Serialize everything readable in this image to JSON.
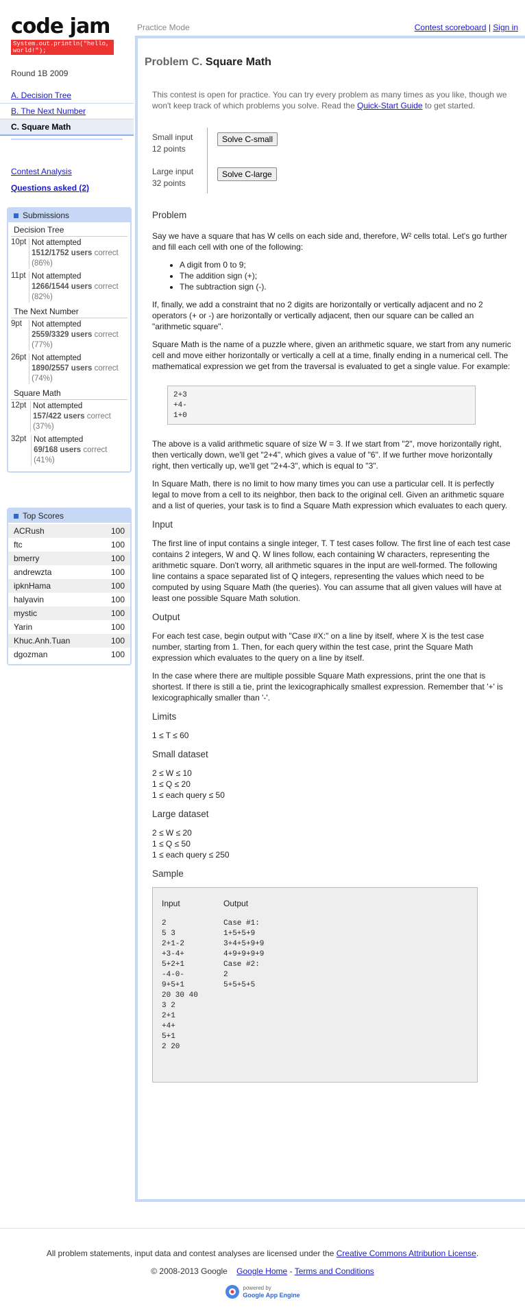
{
  "logo": {
    "text": "code jam",
    "sub": "System.out.println(\"hello, world!\");"
  },
  "round": "Round 1B 2009",
  "nav": [
    "A. Decision Tree",
    "B. The Next Number",
    "C. Square Math"
  ],
  "links": {
    "analysis": "Contest Analysis",
    "questions": "Questions asked (2)"
  },
  "submissions": {
    "title": "Submissions",
    "problems": [
      {
        "name": "Decision Tree",
        "rows": [
          {
            "pts": "10pt",
            "status": "Not attempted",
            "users": "1512/1752 users",
            "correct": "correct (86%)"
          },
          {
            "pts": "11pt",
            "status": "Not attempted",
            "users": "1266/1544 users",
            "correct": "correct (82%)"
          }
        ]
      },
      {
        "name": "The Next Number",
        "rows": [
          {
            "pts": "9pt",
            "status": "Not attempted",
            "users": "2559/3329 users",
            "correct": "correct (77%)"
          },
          {
            "pts": "26pt",
            "status": "Not attempted",
            "users": "1890/2557 users",
            "correct": "correct (74%)"
          }
        ]
      },
      {
        "name": "Square Math",
        "rows": [
          {
            "pts": "12pt",
            "status": "Not attempted",
            "users": "157/422 users",
            "correct": "correct (37%)"
          },
          {
            "pts": "32pt",
            "status": "Not attempted",
            "users": "69/168 users",
            "correct": "correct (41%)"
          }
        ]
      }
    ]
  },
  "topscores": {
    "title": "Top Scores",
    "rows": [
      {
        "name": "ACRush",
        "score": "100"
      },
      {
        "name": "ftc",
        "score": "100"
      },
      {
        "name": "bmerry",
        "score": "100"
      },
      {
        "name": "andrewzta",
        "score": "100"
      },
      {
        "name": "ipknHama",
        "score": "100"
      },
      {
        "name": "halyavin",
        "score": "100"
      },
      {
        "name": "mystic",
        "score": "100"
      },
      {
        "name": "Yarin",
        "score": "100"
      },
      {
        "name": "Khuc.Anh.Tuan",
        "score": "100"
      },
      {
        "name": "dgozman",
        "score": "100"
      }
    ]
  },
  "header": {
    "mode": "Practice Mode",
    "scoreboard": "Contest scoreboard",
    "sep": "|",
    "signin": "Sign in"
  },
  "problem": {
    "prefix": "Problem C.",
    "title": "Square Math",
    "notice": "This contest is open for practice. You can try every problem as many times as you like, though we won't keep track of which problems you solve. Read the",
    "notice_link": "Quick-Start Guide",
    "notice_end": "to get started.",
    "small_label": "Small input",
    "small_pts": "12 points",
    "small_btn": "Solve C-small",
    "large_label": "Large input",
    "large_pts": "32 points",
    "large_btn": "Solve C-large",
    "h_problem": "Problem",
    "p1": "Say we have a square that has W cells on each side and, therefore, W² cells total. Let's go further and fill each cell with one of the following:",
    "bullets": [
      "A digit from 0 to 9;",
      "The addition sign (+);",
      "The subtraction sign (-)."
    ],
    "p2": "If, finally, we add a constraint that no 2 digits are horizontally or vertically adjacent and no 2 operators (+ or -) are horizontally or vertically adjacent, then our square can be called an \"arithmetic square\".",
    "p3": "Square Math is the name of a puzzle where, given an arithmetic square, we start from any numeric cell and move either horizontally or vertically a cell at a time, finally ending in a numerical cell. The mathematical expression we get from the traversal is evaluated to get a single value. For example:",
    "example": "2+3\n+4-\n1+0",
    "p4": "The above is a valid arithmetic square of size W = 3. If we start from \"2\", move horizontally right, then vertically down, we'll get \"2+4\", which gives a value of \"6\". If we further move horizontally right, then vertically up, we'll get \"2+4-3\", which is equal to \"3\".",
    "p5": "In Square Math, there is no limit to how many times you can use a particular cell. It is perfectly legal to move from a cell to its neighbor, then back to the original cell. Given an arithmetic square and a list of queries, your task is to find a Square Math expression which evaluates to each query.",
    "h_input": "Input",
    "p6": "The first line of input contains a single integer, T. T test cases follow. The first line of each test case contains 2 integers, W and Q. W lines follow, each containing W characters, representing the arithmetic square. Don't worry, all arithmetic squares in the input are well-formed. The following line contains a space separated list of Q integers, representing the values which need to be computed by using Square Math (the queries). You can assume that all given values will have at least one possible Square Math solution.",
    "h_output": "Output",
    "p7": "For each test case, begin output with \"Case #X:\" on a line by itself, where X is the test case number, starting from 1. Then, for each query within the test case, print the Square Math expression which evaluates to the query on a line by itself.",
    "p8": "In the case where there are multiple possible Square Math expressions, print the one that is shortest. If there is still a tie, print the lexicographically smallest expression. Remember that '+' is lexicographically smaller than '-'.",
    "h_limits": "Limits",
    "limits": "1 ≤ T ≤ 60",
    "h_small": "Small dataset",
    "small": [
      "2 ≤ W ≤ 10",
      "1 ≤ Q ≤ 20",
      "1 ≤ each query ≤ 50"
    ],
    "h_large": "Large dataset",
    "large": [
      "2 ≤ W ≤ 20",
      "1 ≤ Q ≤ 50",
      "1 ≤ each query ≤ 250"
    ],
    "h_sample": "Sample",
    "sample_in_h": "Input",
    "sample_out_h": "Output",
    "sample_in": "2\n5 3\n2+1-2\n+3-4+\n5+2+1\n-4-0-\n9+5+1\n20 30 40\n3 2\n2+1\n+4+\n5+1\n2 20",
    "sample_out": "Case #1:\n1+5+5+9\n3+4+5+9+9\n4+9+9+9+9\nCase #2:\n2\n5+5+5+5"
  },
  "footer": {
    "license": "All problem statements, input data and contest analyses are licensed under the",
    "license_link": "Creative Commons Attribution License",
    "copyright": "© 2008-2013 Google",
    "home": "Google Home",
    "sep": "-",
    "terms": "Terms and Conditions",
    "powered": "powered by",
    "engine": "Google App Engine"
  }
}
